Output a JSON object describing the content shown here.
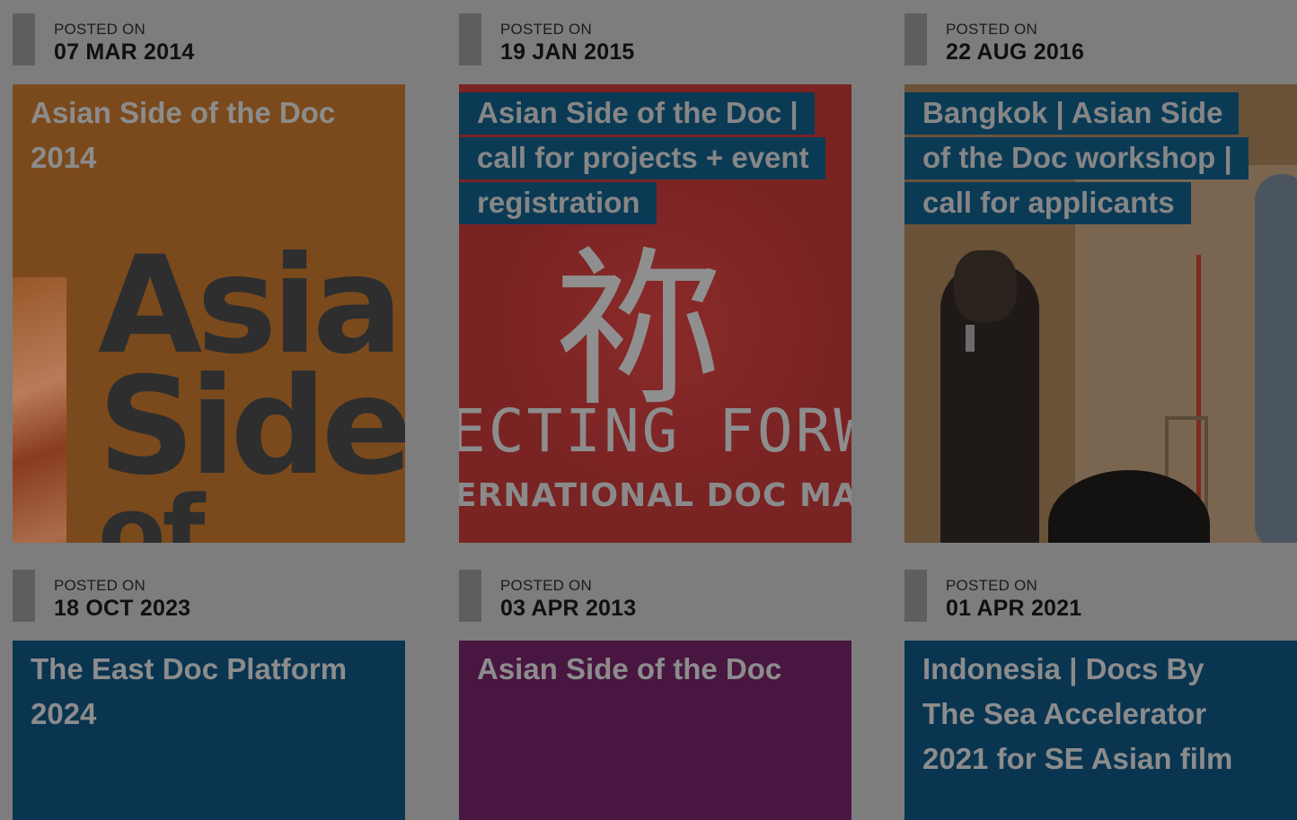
{
  "cards": [
    {
      "posted_label": "POSTED ON",
      "date": "07 MAR 2014",
      "title_lines": [
        "Asian Side of the Doc",
        "2014"
      ],
      "art_text": [
        "Asia",
        "Side",
        "of the I"
      ]
    },
    {
      "posted_label": "POSTED ON",
      "date": "19 JAN 2015",
      "title_lines": [
        "Asian Side of the Doc |",
        "call for projects + event",
        "registration"
      ],
      "art_text": [
        "祢",
        "ECTING FORW",
        "ERNATIONAL DOC MARKET"
      ]
    },
    {
      "posted_label": "POSTED ON",
      "date": "22 AUG 2016",
      "title_lines": [
        "Bangkok | Asian Side",
        "of the Doc workshop |",
        "call for applicants"
      ]
    },
    {
      "posted_label": "POSTED ON",
      "date": "18 OCT 2023",
      "title_lines": [
        "The East Doc Platform",
        "2024"
      ]
    },
    {
      "posted_label": "POSTED ON",
      "date": "03 APR 2013",
      "title_lines": [
        "Asian Side of the Doc"
      ]
    },
    {
      "posted_label": "POSTED ON",
      "date": "01 APR 2021",
      "title_lines": [
        "Indonesia | Docs By",
        "The Sea Accelerator",
        "2021 for SE Asian film"
      ]
    }
  ],
  "colors": {
    "overlay_bg": "#7d7d7d",
    "title_highlight": "#0b3a55",
    "card_blue": "#0a3550",
    "card_purple": "#481641",
    "card_orange": "#7a4a1d",
    "card_red": "#7a2323"
  }
}
